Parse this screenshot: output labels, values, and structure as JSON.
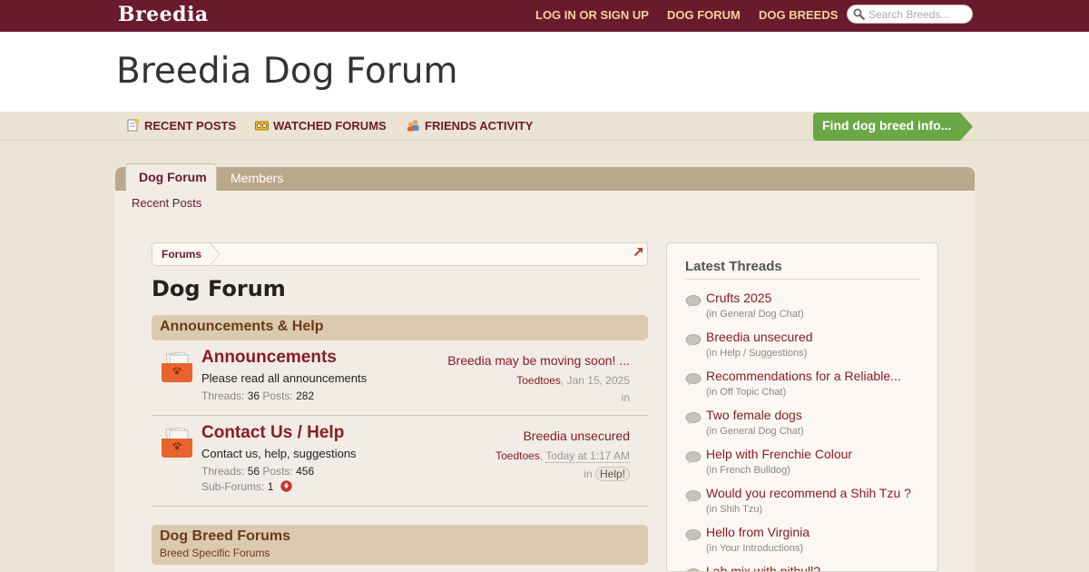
{
  "topbar": {
    "logo": "Breedia",
    "nav": [
      "LOG IN OR SIGN UP",
      "DOG FORUM",
      "DOG BREEDS"
    ],
    "search_placeholder": "Search Breeds..."
  },
  "header": {
    "title": "Breedia Dog Forum"
  },
  "subnav": {
    "items": [
      "RECENT POSTS",
      "WATCHED FORUMS",
      "FRIENDS ACTIVITY"
    ],
    "cta": "Find dog breed info..."
  },
  "tabs": {
    "active": "Dog Forum",
    "inactive": "Members",
    "sublink": "Recent Posts"
  },
  "breadcrumb": {
    "root": "Forums"
  },
  "page": {
    "heading": "Dog Forum"
  },
  "categories": [
    {
      "title": "Announcements & Help",
      "desc": ""
    },
    {
      "title": "Dog Breed Forums",
      "desc": "Breed Specific Forums"
    }
  ],
  "forums": [
    {
      "title": "Announcements",
      "desc": "Please read all announcements",
      "threads_label": "Threads:",
      "threads": "36",
      "posts_label": "Posts:",
      "posts": "282",
      "last_title": "Breedia may be moving soon! ...",
      "last_user": "Toedtoes",
      "last_date": "Jan 15, 2025",
      "in_label": "in",
      "prefix": ""
    },
    {
      "title": "Contact Us / Help",
      "desc": "Contact us, help, suggestions",
      "threads_label": "Threads:",
      "threads": "56",
      "posts_label": "Posts:",
      "posts": "456",
      "subforums_label": "Sub-Forums:",
      "subforums": "1",
      "last_title": "Breedia unsecured",
      "last_user": "Toedtoes",
      "last_date": "Today at 1:17 AM",
      "in_label": "in",
      "prefix": "Help!"
    }
  ],
  "sidebar": {
    "heading": "Latest Threads",
    "threads": [
      {
        "title": "Crufts 2025",
        "forum": "(in General Dog Chat)"
      },
      {
        "title": "Breedia unsecured",
        "forum": "(in Help / Suggestions)"
      },
      {
        "title": "Recommendations for a Reliable...",
        "forum": "(in Off Topic Chat)"
      },
      {
        "title": "Two female dogs",
        "forum": "(in General Dog Chat)"
      },
      {
        "title": "Help with Frenchie Colour",
        "forum": "(in French Bulldog)"
      },
      {
        "title": "Would you recommend a Shih Tzu ?",
        "forum": "(in Shih Tzu)"
      },
      {
        "title": "Hello from Virginia",
        "forum": "(in Your Introductions)"
      },
      {
        "title": "Lab mix with pitbull?",
        "forum": ""
      }
    ]
  },
  "colors": {
    "brand": "#6a1a2d",
    "nav_text": "#f4d39a",
    "cta_green": "#6aa845",
    "link_red": "#8a1c24"
  }
}
